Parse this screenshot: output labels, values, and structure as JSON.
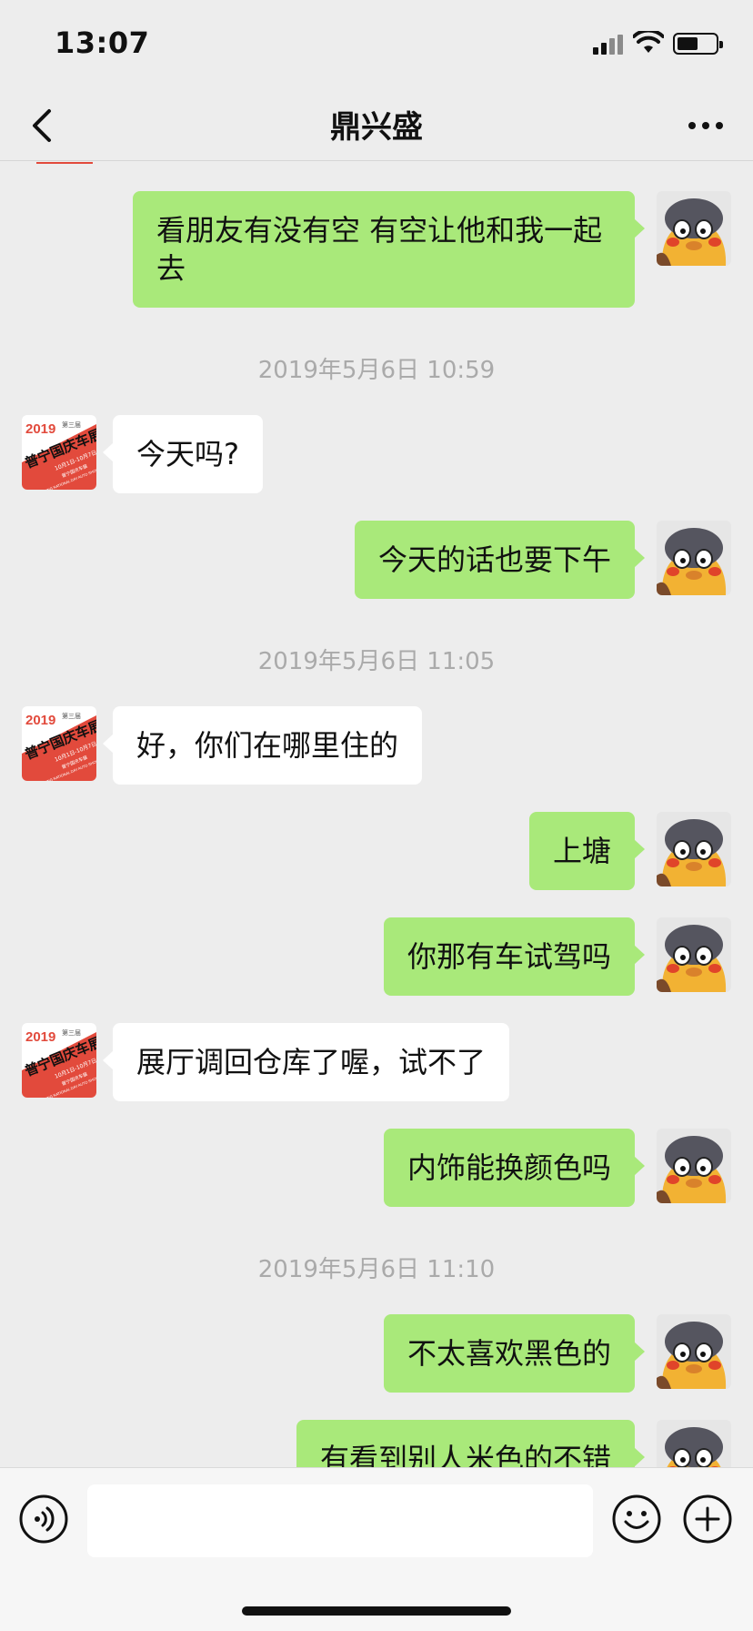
{
  "status_bar": {
    "time": "13:07"
  },
  "header": {
    "title": "鼎兴盛"
  },
  "messages": [
    {
      "side": "right",
      "text": "看朋友有没有空  有空让他和我一起去"
    },
    {
      "side": "left",
      "text": "今天吗?"
    },
    {
      "side": "right",
      "text": "今天的话也要下午"
    },
    {
      "side": "left",
      "text": "好，你们在哪里住的"
    },
    {
      "side": "right",
      "text": "上塘"
    },
    {
      "side": "right",
      "text": "你那有车试驾吗"
    },
    {
      "side": "left",
      "text": "展厅调回仓库了喔，试不了"
    },
    {
      "side": "right",
      "text": "内饰能换颜色吗"
    },
    {
      "side": "right",
      "text": "不太喜欢黑色的"
    },
    {
      "side": "right",
      "text": "有看到别人米色的不错"
    }
  ],
  "timestamps": [
    "2019年5月6日 10:59",
    "2019年5月6日 11:05",
    "2019年5月6日 11:10"
  ],
  "contact_avatar": {
    "year": "2019",
    "title": "普宁国庆车展",
    "edition": "第三届",
    "dates": "10月1日-10月7日",
    "venue": "普宁国庆车展",
    "english": "PUNING NATIONAL DAY AUTO SHOW"
  },
  "input": {
    "value": "",
    "placeholder": ""
  },
  "icons": {
    "back": "chevron-left-icon",
    "more": "more-dots-icon",
    "voice": "voice-icon",
    "emoji": "emoji-icon",
    "plus": "plus-icon"
  },
  "colors": {
    "background": "#ededed",
    "outgoing_bubble": "#a9e97a",
    "incoming_bubble": "#ffffff",
    "timestamp": "#aaaaaa",
    "contact_avatar_red": "#e24a3c"
  }
}
